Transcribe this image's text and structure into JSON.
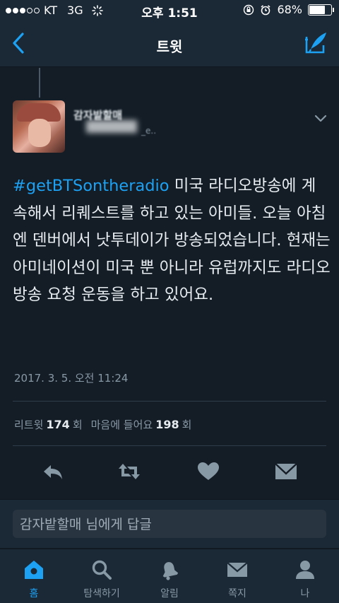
{
  "status_bar": {
    "carrier": "KT",
    "network": "3G",
    "time": "오후 1:51",
    "battery": "68%"
  },
  "nav": {
    "title": "트윗"
  },
  "tweet": {
    "name": "감자밭할매",
    "handle": "_e..",
    "hashtag": "#getBTSontheradio",
    "text": " 미국 라디오방송에 계속해서 리퀘스트를 하고 있는 아미들. 오늘 아침엔 덴버에서 낫투데이가 방송되었습니다. 현재는 아미네이션이 미국 뿐 아니라 유럽까지도 라디오 방송 요청 운동을 하고 있어요.",
    "timestamp": "2017. 3. 5. 오전 11:24"
  },
  "stats": {
    "retweet_label": "리트윗",
    "retweet_count": "174",
    "retweet_unit": "회",
    "like_label": "마음에 들어요",
    "like_count": "198",
    "like_unit": "회"
  },
  "reply": {
    "placeholder": "감자밭할매 님에게 답글"
  },
  "tabs": [
    {
      "label": "홈",
      "icon": "home-icon",
      "active": true
    },
    {
      "label": "탐색하기",
      "icon": "search-icon",
      "active": false
    },
    {
      "label": "알림",
      "icon": "bell-icon",
      "active": false
    },
    {
      "label": "쪽지",
      "icon": "envelope-icon",
      "active": false
    },
    {
      "label": "나",
      "icon": "person-icon",
      "active": false
    }
  ],
  "colors": {
    "accent": "#1da1f2",
    "background": "#141d26",
    "bar": "#1b2836",
    "muted": "#8899a6"
  }
}
